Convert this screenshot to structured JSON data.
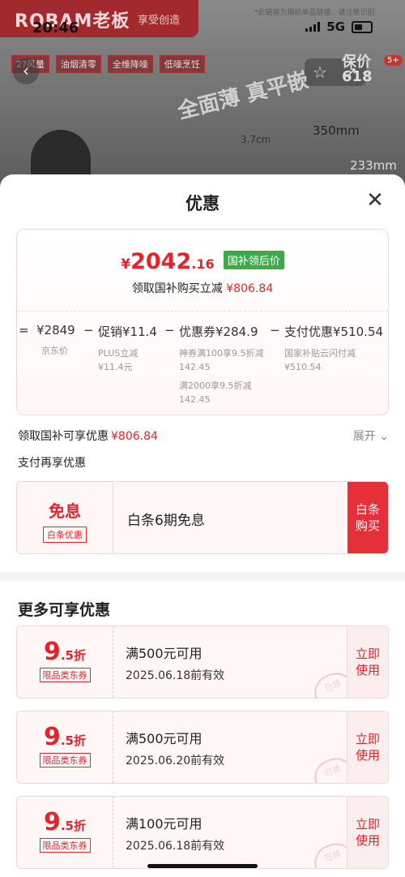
{
  "status_bar": {
    "time": "20:46",
    "network": "5G"
  },
  "background": {
    "brand": "ROBAM老板",
    "slogan": "享受创造",
    "disclaimer": "*此链接为烟机单品链接，请注意识别",
    "tags": [
      "2?风量",
      "油烟清零",
      "全维降噪",
      "低噪烹饪"
    ],
    "promo_label": "保价 618",
    "promo_badge": "5+",
    "headline": "全面薄 真平嵌",
    "dims": [
      "3.7cm",
      "350mm",
      "233mm"
    ]
  },
  "sheet": {
    "title": "优惠",
    "price_card": {
      "final_price": {
        "yen": "¥",
        "integer": "2042",
        "decimal": ".16"
      },
      "subsidy_tag": "国补领后价",
      "claim_text": "领取国补购买立减",
      "claim_amount": "¥806.84",
      "breakdown": [
        {
          "value": "¥2849",
          "label": "京东价",
          "notes": []
        },
        {
          "value": "促销¥11.4",
          "label": "PLUS立减",
          "notes": [
            "¥11.4元"
          ]
        },
        {
          "value": "优惠券¥284.9",
          "label": "神券满100享9.5折减142.45",
          "notes": [
            "满2000享9.5折减142.45"
          ]
        },
        {
          "value": "支付优惠¥510.54",
          "label": "国家补贴云闪付减",
          "notes": [
            "¥510.54"
          ]
        }
      ]
    },
    "subsidy_summary": {
      "text": "领取国补可享优惠",
      "amount": "¥806.84",
      "expand": "展开"
    },
    "pay_section_title": "支付再享优惠",
    "baitiao": {
      "title": "免息",
      "tag": "白条优惠",
      "desc": "白条6期免息",
      "button": "白条购买"
    },
    "more_title": "更多可享优惠",
    "coupons": [
      {
        "discount_big": "9",
        "discount_small": ".5折",
        "tag": "限品类东券",
        "condition": "满500元可用",
        "expiry": "2025.06.18前有效",
        "button": "立即使用",
        "stamp": "已领"
      },
      {
        "discount_big": "9",
        "discount_small": ".5折",
        "tag": "限品类东券",
        "condition": "满500元可用",
        "expiry": "2025.06.20前有效",
        "button": "立即使用",
        "stamp": "已领"
      },
      {
        "discount_big": "9",
        "discount_small": ".5折",
        "tag": "限品类东券",
        "condition": "满100元可用",
        "expiry": "2025.06.18前有效",
        "button": "立即使用",
        "stamp": "已领"
      }
    ]
  },
  "colors": {
    "accent": "#e0262c",
    "green_tag": "#3ea94a",
    "card_border": "#f3d6d6",
    "card_bg": "#fff7f6"
  }
}
